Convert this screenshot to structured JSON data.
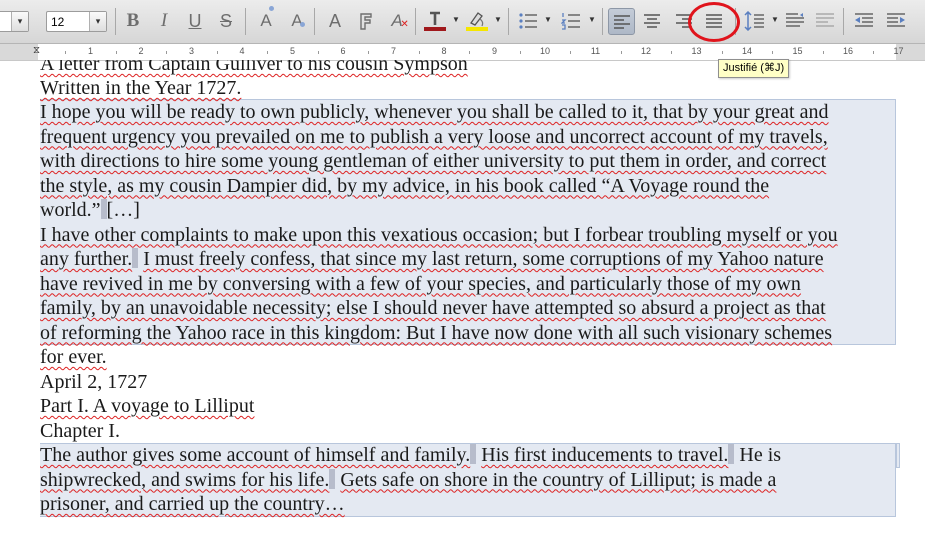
{
  "toolbar": {
    "font_size": "12",
    "icons": {
      "bold": "B",
      "italic": "I",
      "underline": "U",
      "strike": "S",
      "superscript": "A",
      "subscript": "A",
      "clear_format": "A"
    },
    "font_color": "#a0181c",
    "highlight_color": "#f5e600",
    "tooltip": "Justifié (⌘J)"
  },
  "ruler": {
    "numbers": [
      "1",
      "2",
      "3",
      "4",
      "5",
      "6",
      "7",
      "8",
      "9",
      "10",
      "11",
      "12",
      "13",
      "14",
      "15",
      "16",
      "17"
    ]
  },
  "document": {
    "lines": [
      "A letter from Captain Gulliver to his cousin Sympson",
      "Written in the Year 1727.",
      "I hope you will be ready to own publicly, whenever you shall be called to it, that by your great and",
      "frequent urgency you prevailed on me to publish a very loose and uncorrect account of my travels,",
      "with directions to hire some young gentleman of either university to put them in order, and correct",
      "the style, as my cousin Dampier did, by my advice, in his book called “A Voyage round the",
      "world.”",
      "[…]",
      "I have other complaints to make upon this vexatious occasion; but I forbear troubling myself or you",
      "any further.",
      "I must freely confess, that since my last return, some corruptions of my Yahoo nature",
      "have revived in me by conversing with a few of your species, and particularly those of my own",
      "family, by an unavoidable necessity; else I should never have attempted so absurd a project as that",
      "of reforming the Yahoo race in this kingdom: But I have now done with all such visionary schemes",
      "for ever.",
      "April 2, 1727",
      "Part I. A voyage to Lilliput",
      "Chapter I.",
      "The author gives some account of himself and family.",
      "His first inducements to travel.",
      "He is",
      "shipwrecked, and swims for his life.",
      "Gets safe on shore in the country of Lilliput; is made a",
      "prisoner, and carried up the country…"
    ]
  }
}
